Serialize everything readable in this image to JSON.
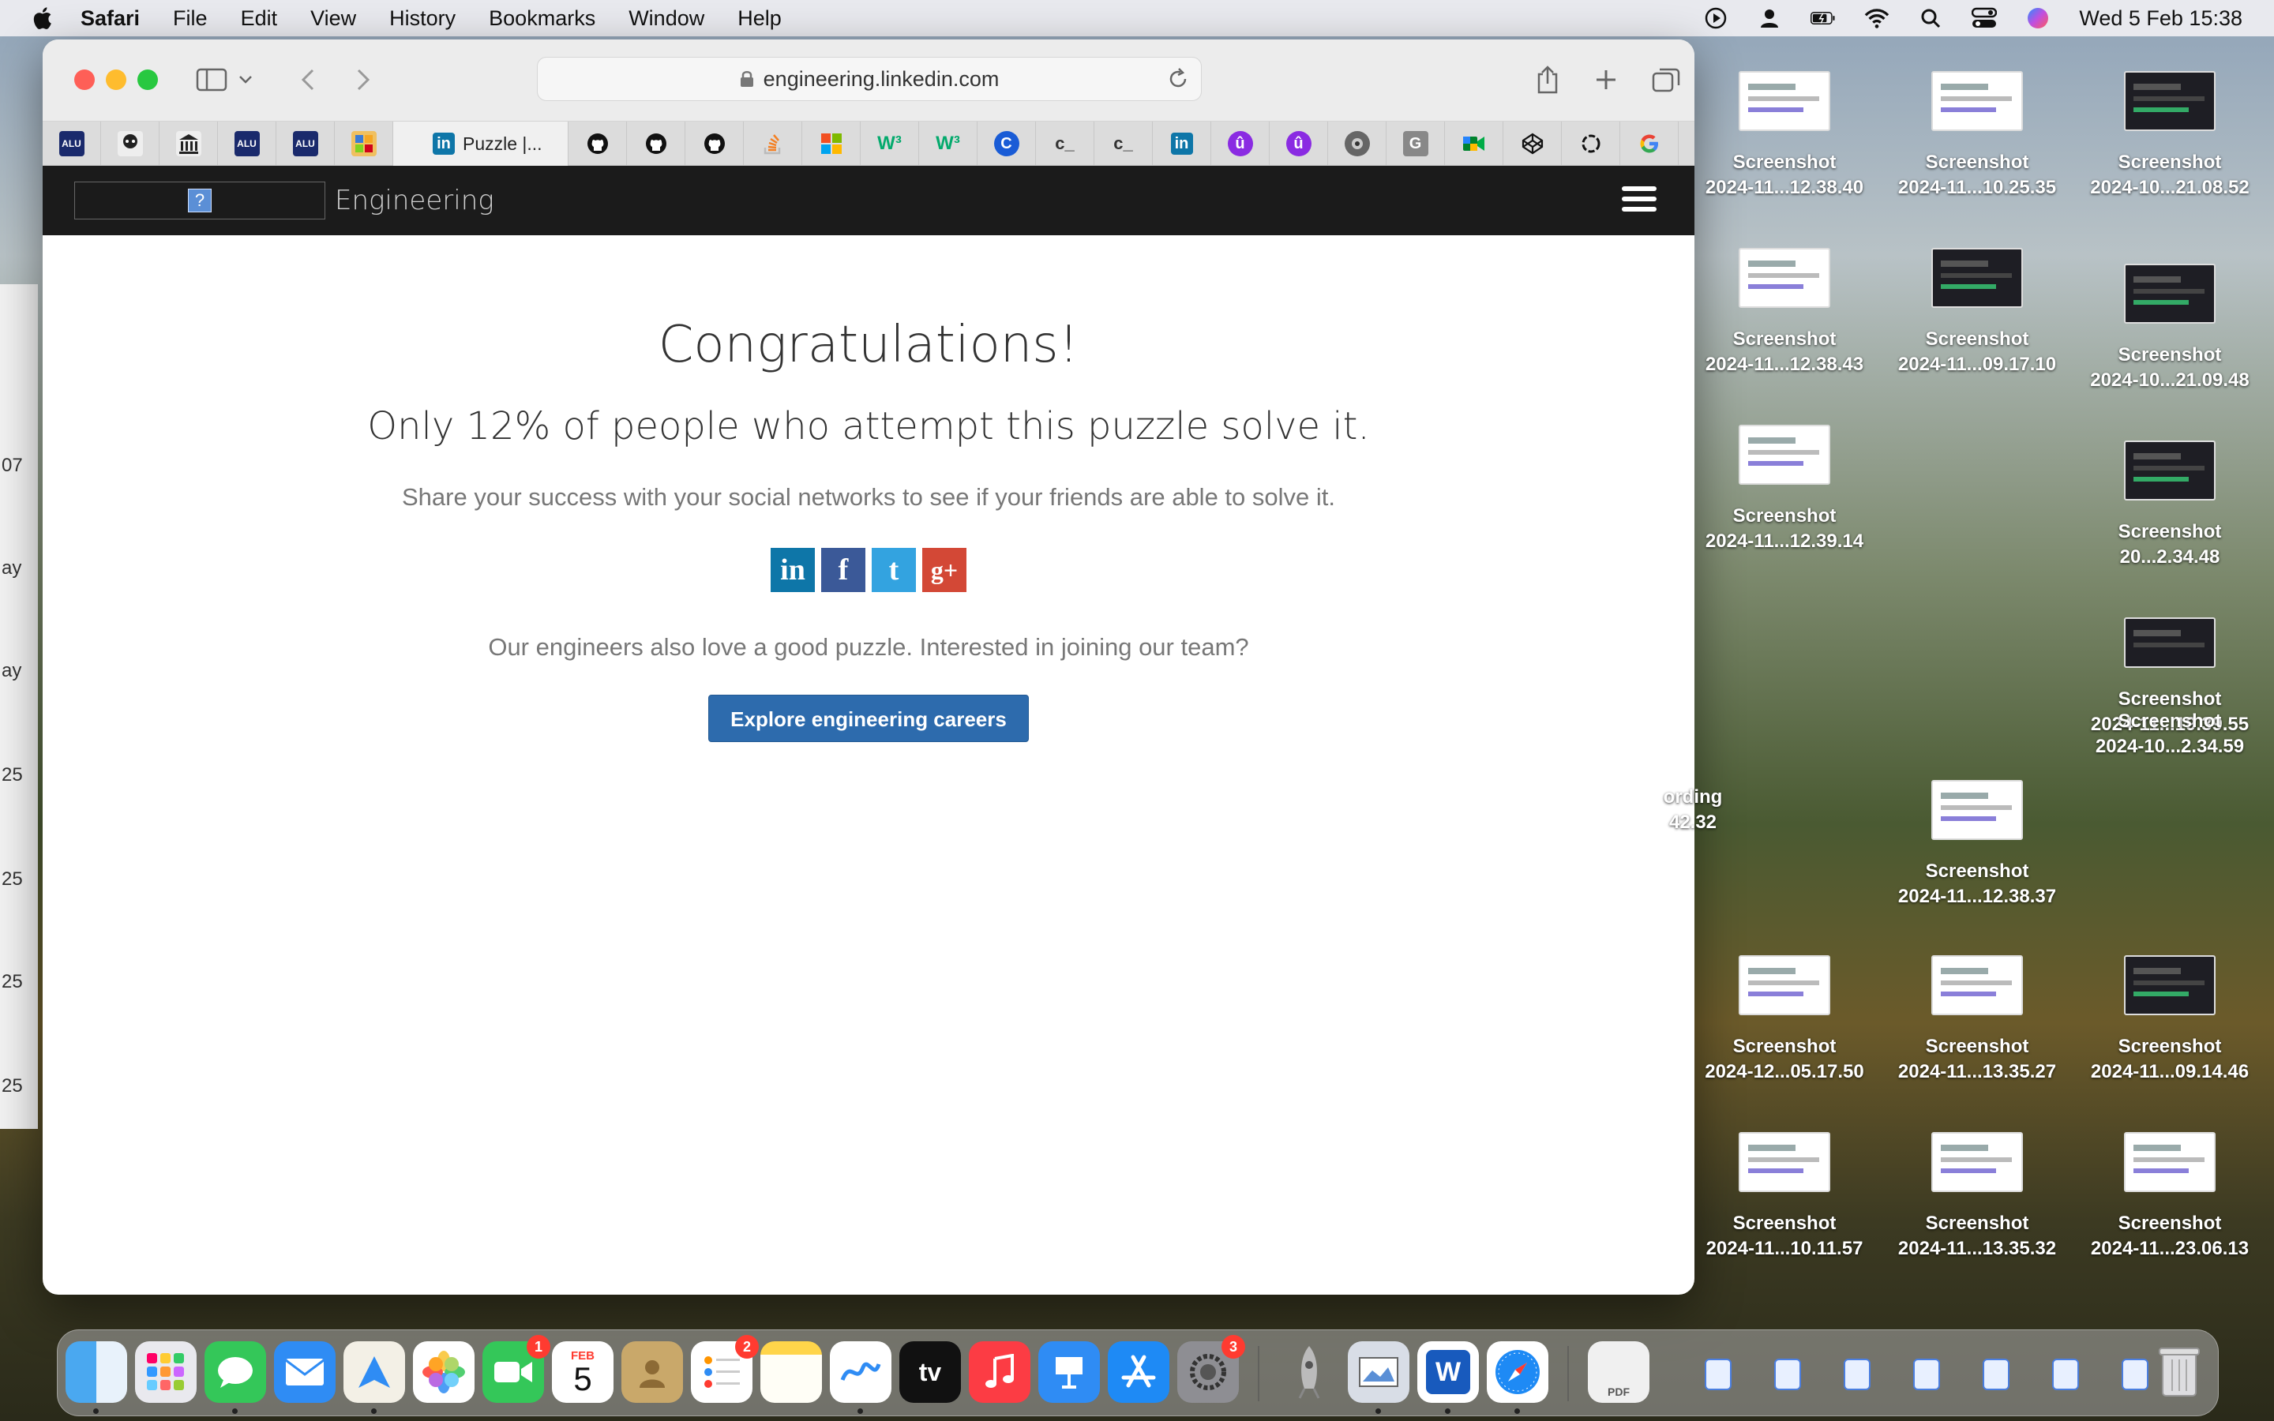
{
  "menubar": {
    "app": "Safari",
    "items": [
      "File",
      "Edit",
      "View",
      "History",
      "Bookmarks",
      "Window",
      "Help"
    ],
    "clock": "Wed 5 Feb  15:38"
  },
  "left_strip": {
    "labels": [
      "07",
      "ay",
      "ay",
      "25",
      "25",
      "25",
      "25"
    ]
  },
  "browser": {
    "url": "engineering.linkedin.com",
    "active_tab": "Puzzle |...",
    "tab_icons": [
      "lw-icon",
      "avatar-icon",
      "bank-icon",
      "lw-icon",
      "lw-icon",
      "photo-icon",
      "linkedin-icon",
      "github-icon",
      "github-icon",
      "github-icon",
      "stackoverflow-icon",
      "microsoft-icon",
      "w3schools-icon",
      "w3schools-icon",
      "c-icon",
      "codechef-icon",
      "codechef-icon",
      "linkedin-icon",
      "u-icon",
      "u-icon",
      "camera-icon",
      "g-icon",
      "meet-icon",
      "codepen-icon",
      "openai-icon",
      "google-icon"
    ]
  },
  "site": {
    "logo_glyph": "?",
    "brand": "Engineering",
    "title": "Congratulations!",
    "stat": "Only 12% of people who attempt this puzzle solve it.",
    "share_text": "Share your success with your social networks to see if your friends are able to solve it.",
    "social": {
      "linkedin": "in",
      "facebook": "f",
      "twitter": "t",
      "googleplus": "g+"
    },
    "team_text": "Our engineers also love a good puzzle. Interested in joining our team?",
    "cta": "Explore engineering careers"
  },
  "desktop_icons": [
    {
      "l1": "Screenshot",
      "l2": "2024-11...12.38.40"
    },
    {
      "l1": "Screenshot",
      "l2": "2024-11...10.25.35"
    },
    {
      "l1": "Screenshot",
      "l2": "2024-10...21.08.52"
    },
    {
      "l1": "Screenshot",
      "l2": "2024-11...12.38.43"
    },
    {
      "l1": "Screenshot",
      "l2": "2024-11...09.17.10"
    },
    {
      "l1": "Screenshot",
      "l2": "2024-10...21.09.48"
    },
    {
      "l1": "Screenshot",
      "l2": "2024-11...12.39.14"
    },
    {
      "l1": "Screenshot",
      "l2": "20...2.34.48"
    },
    {
      "l1": "Screenshot",
      "l2": "2024-11...19.39.55"
    },
    {
      "l1": "Screenshot",
      "l2": "2024-10...2.34.59"
    },
    {
      "l1": "ording",
      "l2": "42.32"
    },
    {
      "l1": "Screenshot",
      "l2": "2024-11...12.38.37"
    },
    {
      "l1": "Screenshot",
      "l2": "2024-12...05.17.50"
    },
    {
      "l1": "Screenshot",
      "l2": "2024-11...13.35.27"
    },
    {
      "l1": "Screenshot",
      "l2": "2024-11...09.14.46"
    },
    {
      "l1": "Screenshot",
      "l2": "2024-11...10.11.57"
    },
    {
      "l1": "Screenshot",
      "l2": "2024-11...13.35.32"
    },
    {
      "l1": "Screenshot",
      "l2": "2024-11...23.06.13"
    }
  ],
  "dock": {
    "facetime_badge": "1",
    "calendar_month": "FEB",
    "calendar_day": "5",
    "reminders_badge": "2",
    "settings_badge": "3",
    "appletv_label": "tv",
    "word_label": "W",
    "pdf_label": "PDF"
  },
  "colors": {
    "nav_bg": "#1b1b1b",
    "cta_bg": "#2d6bad",
    "linkedin": "#0e76a8",
    "facebook": "#3b5998",
    "twitter": "#33a3e0",
    "googleplus": "#d34836"
  }
}
